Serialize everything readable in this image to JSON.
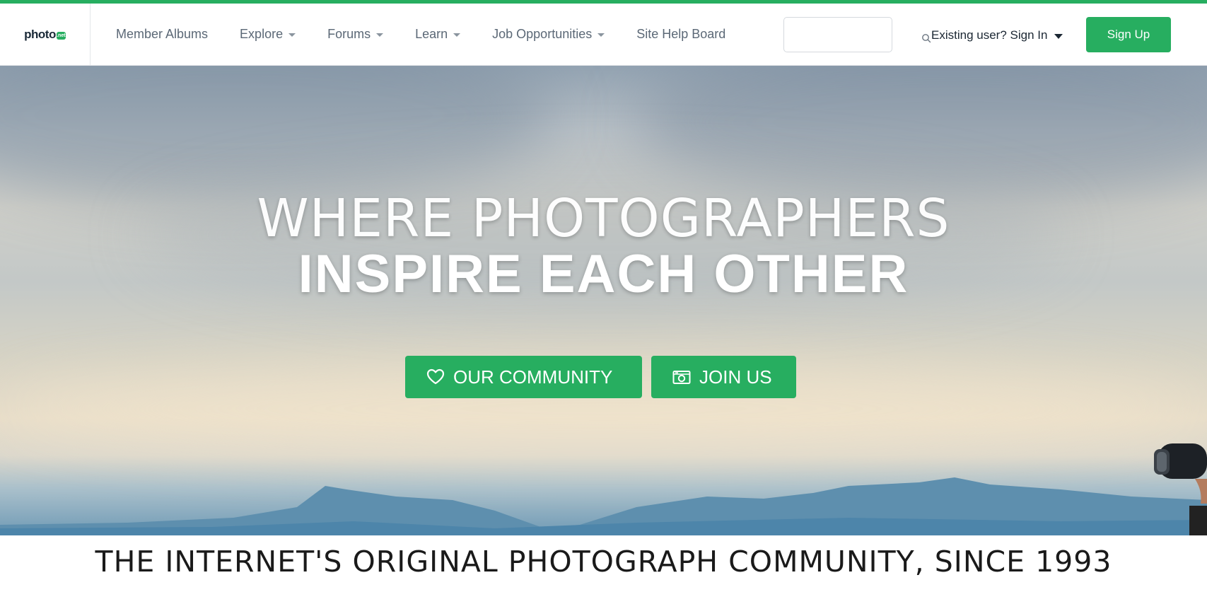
{
  "brand": {
    "logo_text": "photo",
    "logo_badge": ".net",
    "accent_color": "#27ae60"
  },
  "nav": {
    "items": [
      {
        "label": "Member Albums",
        "has_dropdown": false
      },
      {
        "label": "Explore",
        "has_dropdown": true
      },
      {
        "label": "Forums",
        "has_dropdown": true
      },
      {
        "label": "Learn",
        "has_dropdown": true
      },
      {
        "label": "Job Opportunities",
        "has_dropdown": true
      },
      {
        "label": "Site Help Board",
        "has_dropdown": false
      }
    ]
  },
  "search": {
    "value": "",
    "placeholder": "",
    "icon": "search-icon"
  },
  "account": {
    "signin_label": "Existing user? Sign In",
    "signup_label": "Sign Up"
  },
  "hero": {
    "line1": "WHERE PHOTOGRAPHERS",
    "line2": "INSPIRE EACH OTHER",
    "buttons": [
      {
        "label": "OUR COMMUNITY",
        "icon": "heart-icon"
      },
      {
        "label": "JOIN US",
        "icon": "camera-icon"
      }
    ]
  },
  "tagline": "THE INTERNET'S ORIGINAL PHOTOGRAPH COMMUNITY, SINCE 1993"
}
